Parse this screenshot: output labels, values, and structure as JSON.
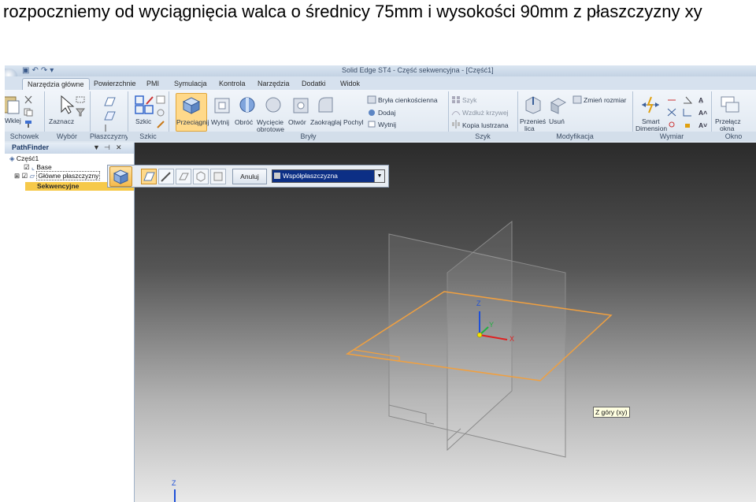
{
  "caption": "rozpoczniemy od wyciągnięcia walca o średnicy 75mm i wysokości 90mm z płaszczyzny xy",
  "window_title": "Solid Edge ST4 - Część sekwencyjna - [Część1]",
  "tabs": [
    "Narzędzia główne",
    "Powierzchnie",
    "PMI",
    "Symulacja",
    "Kontrola",
    "Narzędzia",
    "Dodatki",
    "Widok"
  ],
  "ribbon": {
    "groups": {
      "schowek": "Schowek",
      "wybor": "Wybór",
      "plaszczyzny": "Płaszczyzny",
      "szkic": "Szkic",
      "bryly": "Bryły",
      "szyk": "Szyk",
      "modyfikacja": "Modyfikacja",
      "wymiar": "Wymiar",
      "okno": "Okno"
    },
    "buttons": {
      "wklej": "Wklej",
      "zaznacz": "Zaznacz",
      "szkic": "Szkic",
      "przeciagnij": "Przeciągnij",
      "wytnij": "Wytnij",
      "obroc": "Obróć",
      "wyciecie_obrotowe_1": "Wycięcie",
      "wyciecie_obrotowe_2": "obrotowe",
      "otwor": "Otwór",
      "zaokraglaj": "Zaokrąglaj",
      "pochyl": "Pochyl",
      "bryla_cienkoscienna": "Bryła cienkościenna",
      "dodaj": "Dodaj",
      "wytnij_small": "Wytnij",
      "szyk": "Szyk",
      "wzdluz_krzywej": "Wzdłuż krzywej",
      "kopia_lustrzana": "Kopia lustrzana",
      "przenies_lica_1": "Przenieś",
      "przenies_lica_2": "lica",
      "usun": "Usuń",
      "zmien_rozmiar": "Zmień rozmiar",
      "smart_dimension_1": "Smart",
      "smart_dimension_2": "Dimension",
      "przelacz_okna_1": "Przełącz",
      "przelacz_okna_2": "okna"
    }
  },
  "pathfinder": {
    "title": "PathFinder",
    "items": [
      "Część1",
      "Base",
      "Główne płaszczyzny",
      "Sekwencyjne"
    ]
  },
  "command_bar": {
    "cancel": "Anuluj",
    "plane_option": "Współpłaszczyzna"
  },
  "tooltip": "Z góry (xy)",
  "triad": {
    "z": "Z",
    "y": "Y",
    "x": "X"
  },
  "colors": {
    "selected_plane": "#f0a040",
    "axis_x": "#e02020",
    "axis_y": "#20b040",
    "axis_z": "#1e50d8",
    "origin": "#f2e200"
  }
}
